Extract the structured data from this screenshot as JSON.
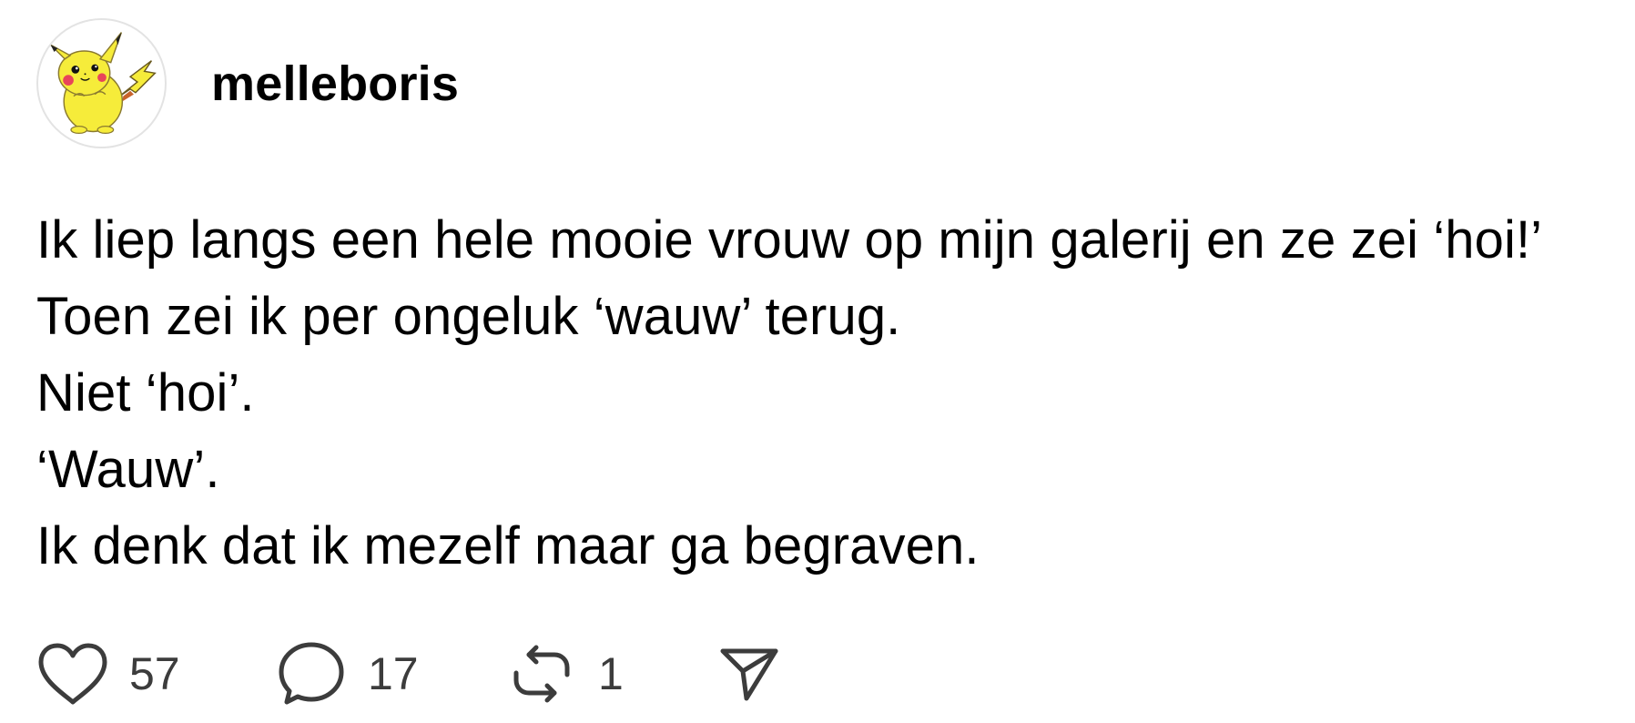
{
  "post": {
    "username": "melleboris",
    "avatar_icon": "pikachu-avatar",
    "lines": [
      "Ik liep langs een hele mooie vrouw op mijn galerij en ze zei ‘hoi!’",
      "Toen zei ik per ongeluk ‘wauw’ terug.",
      "Niet ‘hoi’.",
      "‘Wauw’.",
      "Ik denk dat ik mezelf maar ga begraven."
    ],
    "actions": {
      "like": {
        "icon": "heart-icon",
        "count": "57"
      },
      "comment": {
        "icon": "comment-bubble-icon",
        "count": "17"
      },
      "repost": {
        "icon": "repost-icon",
        "count": "1"
      },
      "share": {
        "icon": "send-icon"
      }
    }
  },
  "colors": {
    "text": "#000000",
    "count_text": "#3c3c3c",
    "icon_stroke": "#3c3c3c",
    "avatar_yellow": "#f6ec3a"
  }
}
